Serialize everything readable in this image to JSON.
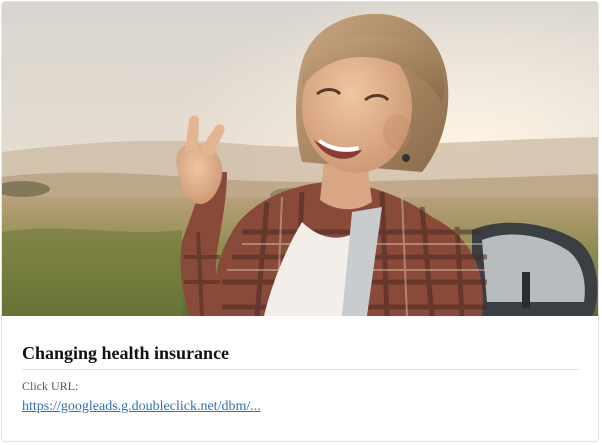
{
  "ad": {
    "title": "Changing health insurance",
    "click_url_label": "Click URL:",
    "click_url": "https://googleads.g.doubleclick.net/dbm/..."
  },
  "image": {
    "subject": "smiling woman taking a selfie outdoors, making a peace sign, wearing a plaid shirt and backpack"
  },
  "colors": {
    "link": "#2f6fb7",
    "title": "#111111",
    "meta": "#555555",
    "divider": "#e1e1e1"
  }
}
